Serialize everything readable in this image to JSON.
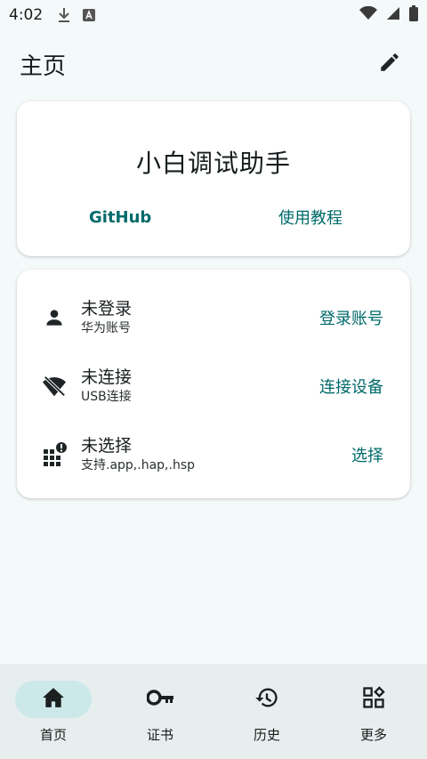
{
  "status_bar": {
    "time": "4:02",
    "icons": [
      "download-icon",
      "font-app-icon",
      "wifi-icon",
      "signal-icon",
      "battery-icon"
    ]
  },
  "app_bar": {
    "title": "主页",
    "edit_icon": "pencil-icon"
  },
  "hero": {
    "app_name": "小白调试助手",
    "github_label": "GitHub",
    "tutorial_label": "使用教程"
  },
  "rows": [
    {
      "icon": "person-icon",
      "title": "未登录",
      "subtitle": "华为账号",
      "action": "登录账号"
    },
    {
      "icon": "wifi-off-icon",
      "title": "未连接",
      "subtitle": "USB连接",
      "action": "连接设备"
    },
    {
      "icon": "apps-alert-icon",
      "title": "未选择",
      "subtitle": "支持.app,.hap,.hsp",
      "action": "选择"
    }
  ],
  "bottom_nav": [
    {
      "icon": "home-icon",
      "label": "首页",
      "active": true
    },
    {
      "icon": "key-icon",
      "label": "证书",
      "active": false
    },
    {
      "icon": "history-icon",
      "label": "历史",
      "active": false
    },
    {
      "icon": "widgets-icon",
      "label": "更多",
      "active": false
    }
  ],
  "colors": {
    "background": "#f4f9f9",
    "accent": "#006a6a",
    "nav_background": "#e7eeee",
    "active_indicator": "#cce8e9"
  }
}
